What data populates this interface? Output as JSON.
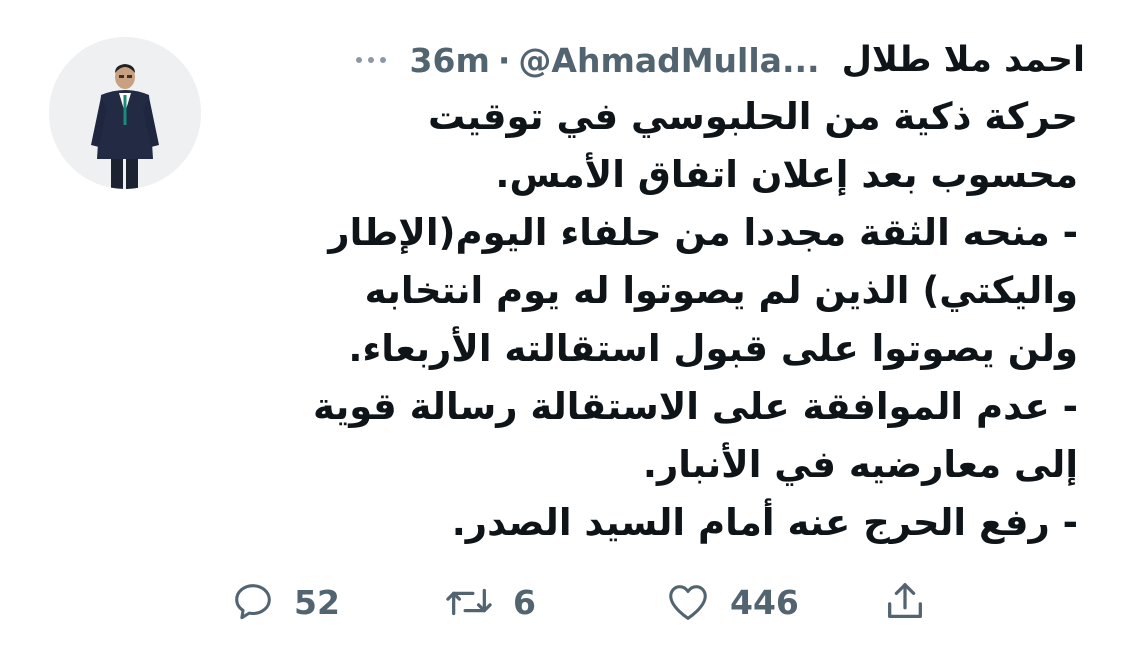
{
  "tweet": {
    "author_name": "احمد ملا طلال",
    "handle": "@AhmadMulla...",
    "separator": "·",
    "time": "36m",
    "lines": [
      "حركة ذكية من الحلبوسي في توقيت",
      "محسوب بعد إعلان اتفاق الأمس.",
      "- منحه الثقة مجددا من حلفاء اليوم(الإطار",
      "واليكتي) الذين لم يصوتوا له يوم انتخابه",
      "ولن يصوتوا على قبول استقالته الأربعاء.",
      "- عدم الموافقة على الاستقالة رسالة قوية",
      "إلى معارضيه في الأنبار.",
      "- رفع الحرج عنه أمام السيد الصدر."
    ]
  },
  "actions": {
    "reply_count": "52",
    "retweet_count": "6",
    "like_count": "446"
  },
  "icons": {
    "more": "more-dots-icon",
    "reply": "reply-bubble-icon",
    "retweet": "retweet-icon",
    "like": "heart-icon",
    "share": "share-icon"
  },
  "colors": {
    "text": "#0f1419",
    "secondary": "#536471",
    "icon": "#536471"
  }
}
